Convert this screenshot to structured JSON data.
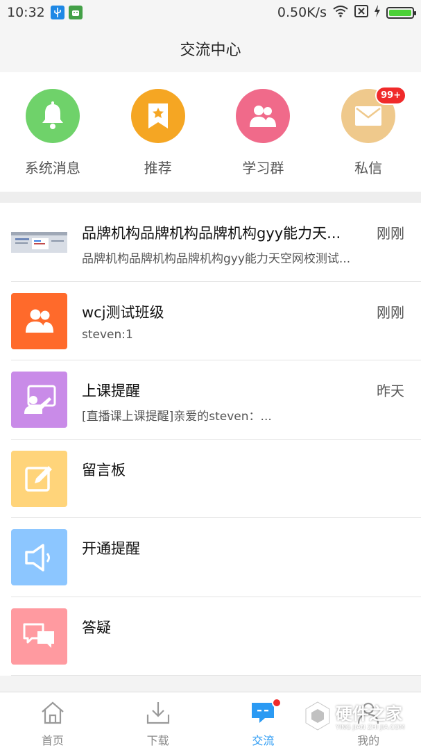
{
  "status_bar": {
    "time": "10:32",
    "speed": "0.50K/s"
  },
  "header": {
    "title": "交流中心"
  },
  "quick": [
    {
      "label": "系统消息",
      "icon": "bell-icon",
      "color": "#6fd26a"
    },
    {
      "label": "推荐",
      "icon": "bookmark-star-icon",
      "color": "#f5a623"
    },
    {
      "label": "学习群",
      "icon": "group-icon",
      "color": "#f06a8a"
    },
    {
      "label": "私信",
      "icon": "mail-icon",
      "color": "#efc98c",
      "badge": "99+"
    }
  ],
  "list": [
    {
      "title": "品牌机构品牌机构品牌机构gyy能力天...",
      "subtitle": "品牌机构品牌机构品牌机构gyy能力天空网校测试...",
      "time": "刚刚",
      "icon": "screenshot-thumbnail"
    },
    {
      "title": "wcj测试班级",
      "subtitle": "steven:1",
      "time": "刚刚",
      "icon": "group-icon",
      "color": "#ff6a2b"
    },
    {
      "title": "上课提醒",
      "subtitle": "[直播课上课提醒]亲爱的steven：...",
      "time": "昨天",
      "icon": "teacher-board-icon",
      "color": "#c98be8"
    },
    {
      "title": "留言板",
      "subtitle": "",
      "time": "",
      "icon": "note-edit-icon",
      "color": "#ffd47a"
    },
    {
      "title": "开通提醒",
      "subtitle": "",
      "time": "",
      "icon": "speaker-icon",
      "color": "#8cc6ff"
    },
    {
      "title": "答疑",
      "subtitle": "",
      "time": "",
      "icon": "chat-bubbles-icon",
      "color": "#ff9aa0"
    }
  ],
  "tabs": [
    {
      "label": "首页",
      "icon": "home-icon"
    },
    {
      "label": "下载",
      "icon": "download-icon"
    },
    {
      "label": "交流",
      "icon": "message-icon",
      "active": true
    },
    {
      "label": "我的",
      "icon": "profile-icon"
    }
  ],
  "watermark": {
    "text": "硬件之家",
    "sub": "YING JIAN ZHI JIA.COM"
  },
  "colors": {
    "accent": "#2b9af3",
    "badge": "#f02a2a"
  }
}
